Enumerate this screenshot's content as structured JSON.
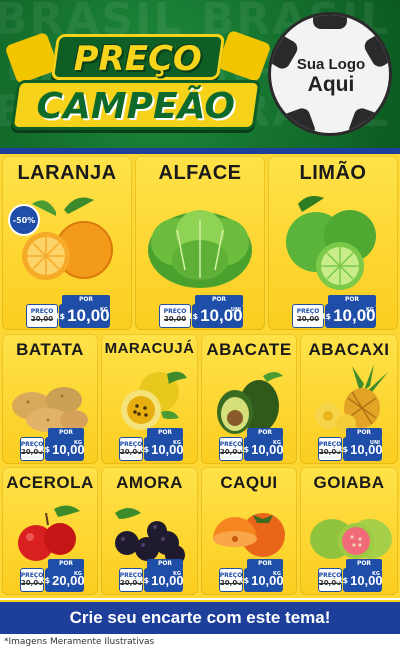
{
  "header": {
    "bg_word": "BRASIL BRASIL",
    "title_line1": "PREÇO",
    "title_line2": "CAMPEÃO",
    "logo_line1": "Sua Logo",
    "logo_line2": "Aqui"
  },
  "price_labels": {
    "old_label": "PREÇO",
    "new_label": "POR",
    "currency": "R$",
    "unit": "KG",
    "unit_each": "UNI"
  },
  "products": [
    {
      "name": "LARANJA",
      "old_price": "20,00",
      "new_price": "10,00",
      "unit": "KG",
      "discount": "-50%",
      "icon": "orange-icon"
    },
    {
      "name": "ALFACE",
      "old_price": "20,00",
      "new_price": "10,00",
      "unit": "UNI",
      "icon": "lettuce-icon"
    },
    {
      "name": "LIMÃO",
      "old_price": "20,00",
      "new_price": "10,00",
      "unit": "KG",
      "icon": "lime-icon"
    },
    {
      "name": "BATATA",
      "old_price": "20,00",
      "new_price": "10,00",
      "unit": "KG",
      "icon": "potato-icon"
    },
    {
      "name": "MARACUJÁ",
      "old_price": "20,00",
      "new_price": "10,00",
      "unit": "KG",
      "icon": "passion-fruit-icon"
    },
    {
      "name": "ABACATE",
      "old_price": "20,00",
      "new_price": "10,00",
      "unit": "KG",
      "icon": "avocado-icon"
    },
    {
      "name": "ABACAXI",
      "old_price": "20,00",
      "new_price": "10,00",
      "unit": "UNI",
      "icon": "pineapple-icon"
    },
    {
      "name": "ACEROLA",
      "old_price": "20,00",
      "new_price": "20,00",
      "unit": "KG",
      "icon": "acerola-icon"
    },
    {
      "name": "AMORA",
      "old_price": "20,00",
      "new_price": "10,00",
      "unit": "KG",
      "icon": "blackberry-icon"
    },
    {
      "name": "CAQUI",
      "old_price": "20,00",
      "new_price": "10,00",
      "unit": "KG",
      "icon": "persimmon-icon"
    },
    {
      "name": "GOIABA",
      "old_price": "20,00",
      "new_price": "10,00",
      "unit": "KG",
      "icon": "guava-icon"
    }
  ],
  "footer": {
    "cta": "Crie seu encarte com este tema!",
    "disclaimer": "*Imagens Meramente Ilustrativas"
  },
  "colors": {
    "green": "#14702d",
    "yellow": "#fdd835",
    "blue": "#1f4ea8",
    "dark_blue": "#1d3f9a"
  }
}
